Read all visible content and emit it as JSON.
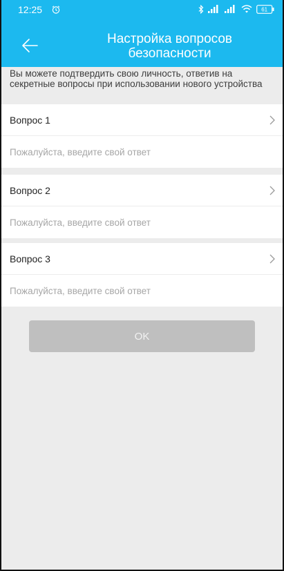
{
  "status_bar": {
    "time": "12:25",
    "battery": "61"
  },
  "header": {
    "title": "Настройка вопросов безопасности"
  },
  "info": {
    "text": "Вы можете подтвердить свою личность, ответив на секретные вопросы при использовании нового устройства"
  },
  "questions": [
    {
      "label": "Вопрос 1",
      "answer_placeholder": "Пожалуйста, введите свой ответ"
    },
    {
      "label": "Вопрос 2",
      "answer_placeholder": "Пожалуйста, введите свой ответ"
    },
    {
      "label": "Вопрос 3",
      "answer_placeholder": "Пожалуйста, введите свой ответ"
    }
  ],
  "ok_button": {
    "label": "OK"
  },
  "colors": {
    "header": "#1cb9ef",
    "background": "#ececec",
    "button_disabled": "#bfbfbf"
  }
}
